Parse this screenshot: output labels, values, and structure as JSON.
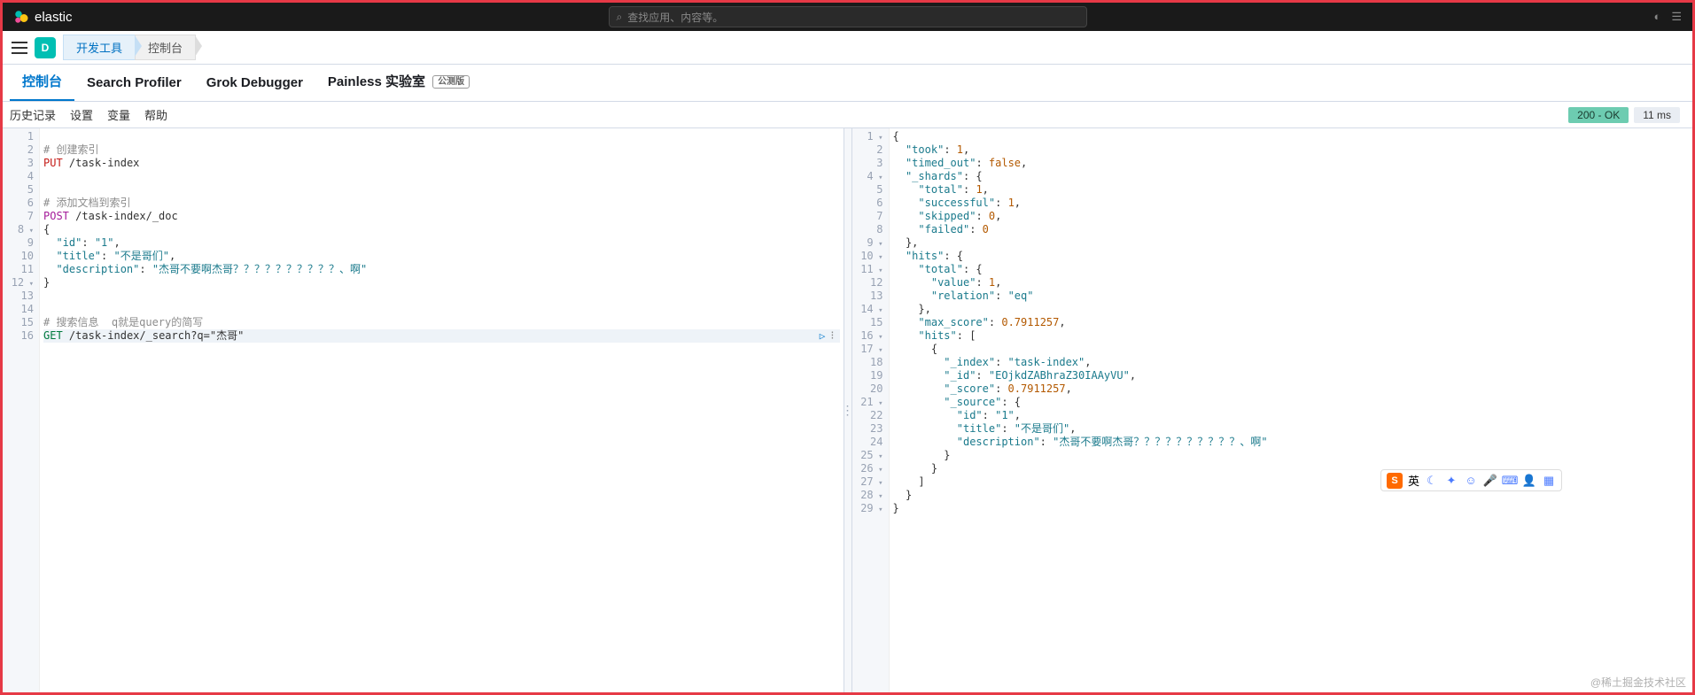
{
  "brand": "elastic",
  "search_placeholder": "查找应用、内容等。",
  "space_letter": "D",
  "breadcrumbs": {
    "devtools": "开发工具",
    "console": "控制台"
  },
  "tabs": {
    "console": "控制台",
    "profiler": "Search Profiler",
    "grok": "Grok Debugger",
    "painless": "Painless 实验室",
    "beta": "公测版"
  },
  "subtoolbar": {
    "history": "历史记录",
    "settings": "设置",
    "variables": "变量",
    "help": "帮助"
  },
  "status": {
    "code": "200 - OK",
    "time": "11 ms"
  },
  "request": {
    "lines": [
      {
        "n": 1,
        "raw": ""
      },
      {
        "n": 2,
        "type": "comment",
        "text": "# 创建索引"
      },
      {
        "n": 3,
        "type": "req",
        "method": "PUT",
        "path": "/task-index"
      },
      {
        "n": 4,
        "raw": ""
      },
      {
        "n": 5,
        "raw": ""
      },
      {
        "n": 6,
        "type": "comment",
        "text": "# 添加文档到索引"
      },
      {
        "n": 7,
        "type": "req",
        "method": "POST",
        "path": "/task-index/_doc"
      },
      {
        "n": 8,
        "raw": "{",
        "fold": true
      },
      {
        "n": 9,
        "type": "kv",
        "indent": 2,
        "key": "\"id\"",
        "val": "\"1\"",
        "comma": true
      },
      {
        "n": 10,
        "type": "kv",
        "indent": 2,
        "key": "\"title\"",
        "val": "\"不是哥们\"",
        "comma": true
      },
      {
        "n": 11,
        "type": "kv",
        "indent": 2,
        "key": "\"description\"",
        "val": "\"杰哥不要啊杰哥？？？？？？？？？？、啊\""
      },
      {
        "n": 12,
        "raw": "}",
        "fold": true
      },
      {
        "n": 13,
        "raw": ""
      },
      {
        "n": 14,
        "raw": ""
      },
      {
        "n": 15,
        "type": "comment",
        "text": "# 搜索信息  q就是query的简写"
      },
      {
        "n": 16,
        "type": "req",
        "method": "GET",
        "path": "/task-index/_search?q=\"杰哥\"",
        "hl": true,
        "actions": true
      }
    ]
  },
  "response": {
    "lines": [
      {
        "n": 1,
        "raw": "{",
        "fold": true
      },
      {
        "n": 2,
        "type": "kv",
        "indent": 2,
        "key": "\"took\"",
        "valnum": "1",
        "comma": true
      },
      {
        "n": 3,
        "type": "kv",
        "indent": 2,
        "key": "\"timed_out\"",
        "valbool": "false",
        "comma": true
      },
      {
        "n": 4,
        "type": "kopen",
        "indent": 2,
        "key": "\"_shards\"",
        "open": "{",
        "fold": true
      },
      {
        "n": 5,
        "type": "kv",
        "indent": 4,
        "key": "\"total\"",
        "valnum": "1",
        "comma": true
      },
      {
        "n": 6,
        "type": "kv",
        "indent": 4,
        "key": "\"successful\"",
        "valnum": "1",
        "comma": true
      },
      {
        "n": 7,
        "type": "kv",
        "indent": 4,
        "key": "\"skipped\"",
        "valnum": "0",
        "comma": true
      },
      {
        "n": 8,
        "type": "kv",
        "indent": 4,
        "key": "\"failed\"",
        "valnum": "0"
      },
      {
        "n": 9,
        "raw": "  },",
        "fold": true
      },
      {
        "n": 10,
        "type": "kopen",
        "indent": 2,
        "key": "\"hits\"",
        "open": "{",
        "fold": true
      },
      {
        "n": 11,
        "type": "kopen",
        "indent": 4,
        "key": "\"total\"",
        "open": "{",
        "fold": true
      },
      {
        "n": 12,
        "type": "kv",
        "indent": 6,
        "key": "\"value\"",
        "valnum": "1",
        "comma": true
      },
      {
        "n": 13,
        "type": "kv",
        "indent": 6,
        "key": "\"relation\"",
        "val": "\"eq\""
      },
      {
        "n": 14,
        "raw": "    },",
        "fold": true
      },
      {
        "n": 15,
        "type": "kv",
        "indent": 4,
        "key": "\"max_score\"",
        "valnum": "0.7911257",
        "comma": true
      },
      {
        "n": 16,
        "type": "kopen",
        "indent": 4,
        "key": "\"hits\"",
        "open": "[",
        "fold": true
      },
      {
        "n": 17,
        "raw": "      {",
        "fold": true
      },
      {
        "n": 18,
        "type": "kv",
        "indent": 8,
        "key": "\"_index\"",
        "val": "\"task-index\"",
        "comma": true
      },
      {
        "n": 19,
        "type": "kv",
        "indent": 8,
        "key": "\"_id\"",
        "val": "\"EOjkdZABhraZ30IAAyVU\"",
        "comma": true
      },
      {
        "n": 20,
        "type": "kv",
        "indent": 8,
        "key": "\"_score\"",
        "valnum": "0.7911257",
        "comma": true
      },
      {
        "n": 21,
        "type": "kopen",
        "indent": 8,
        "key": "\"_source\"",
        "open": "{",
        "fold": true
      },
      {
        "n": 22,
        "type": "kv",
        "indent": 10,
        "key": "\"id\"",
        "val": "\"1\"",
        "comma": true
      },
      {
        "n": 23,
        "type": "kv",
        "indent": 10,
        "key": "\"title\"",
        "val": "\"不是哥们\"",
        "comma": true
      },
      {
        "n": 24,
        "type": "kv",
        "indent": 10,
        "key": "\"description\"",
        "val": "\"杰哥不要啊杰哥？？？？？？？？？？、啊\""
      },
      {
        "n": 25,
        "raw": "        }",
        "fold": true
      },
      {
        "n": 26,
        "raw": "      }",
        "fold": true
      },
      {
        "n": 27,
        "raw": "    ]",
        "fold": true
      },
      {
        "n": 28,
        "raw": "  }",
        "fold": true
      },
      {
        "n": 29,
        "raw": "}",
        "fold": true
      }
    ]
  },
  "watermark": "@稀土掘金技术社区",
  "ime": {
    "lang": "英"
  }
}
